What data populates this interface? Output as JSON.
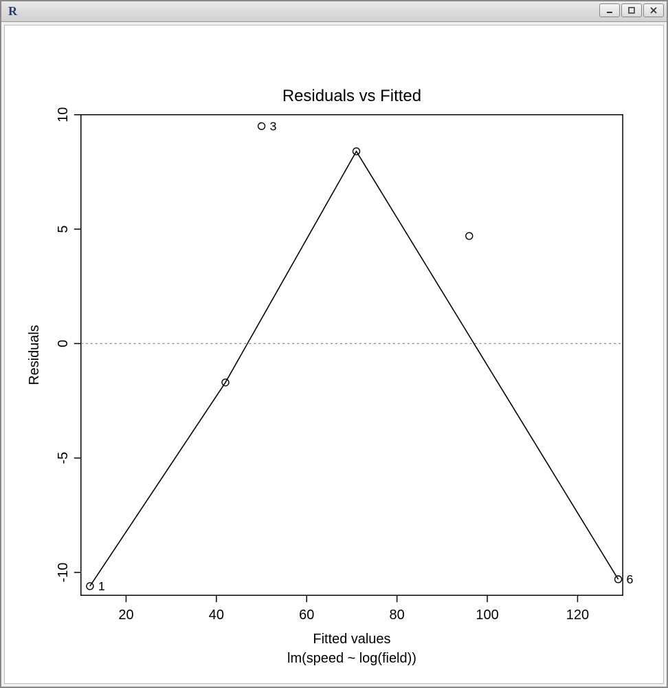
{
  "window": {
    "app_icon_text": "R",
    "minimize_tooltip": "Minimize",
    "maximize_tooltip": "Maximize",
    "close_tooltip": "Close"
  },
  "chart_data": {
    "type": "scatter",
    "title": "Residuals vs Fitted",
    "xlabel": "Fitted values",
    "subcaption": "lm(speed ~ log(field))",
    "ylabel": "Residuals",
    "xlim": [
      10,
      130
    ],
    "ylim": [
      -11,
      10
    ],
    "xticks": [
      20,
      40,
      60,
      80,
      100,
      120
    ],
    "yticks": [
      -10,
      -5,
      0,
      5,
      10
    ],
    "reference_line_y": 0,
    "points": [
      {
        "x": 12,
        "y": -10.6,
        "label": "1"
      },
      {
        "x": 42,
        "y": -1.7
      },
      {
        "x": 50,
        "y": 9.5,
        "label": "3"
      },
      {
        "x": 71,
        "y": 8.4
      },
      {
        "x": 96,
        "y": 4.7
      },
      {
        "x": 129,
        "y": -10.3,
        "label": "6"
      }
    ],
    "lowess_line": [
      {
        "x": 12,
        "y": -10.6
      },
      {
        "x": 42,
        "y": -1.7
      },
      {
        "x": 71,
        "y": 8.4
      },
      {
        "x": 129,
        "y": -10.3
      }
    ]
  }
}
